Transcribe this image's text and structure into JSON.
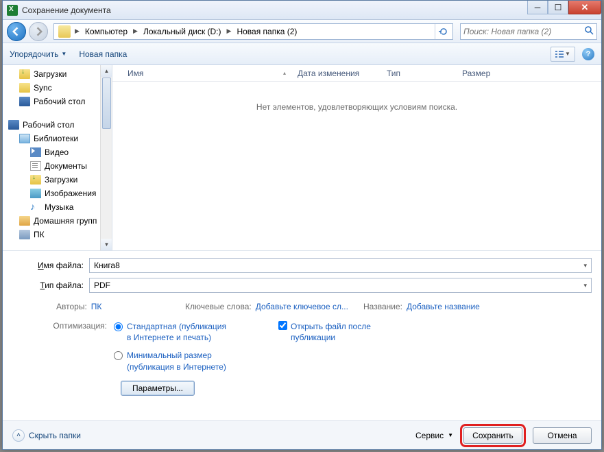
{
  "title": "Сохранение документа",
  "breadcrumb": [
    "Компьютер",
    "Локальный диск (D:)",
    "Новая папка (2)"
  ],
  "search_placeholder": "Поиск: Новая папка (2)",
  "toolbar": {
    "organize": "Упорядочить",
    "new_folder": "Новая папка"
  },
  "tree": {
    "downloads": "Загрузки",
    "sync": "Sync",
    "desktop1": "Рабочий стол",
    "desktop2": "Рабочий стол",
    "libraries": "Библиотеки",
    "video": "Видео",
    "documents": "Документы",
    "downloads2": "Загрузки",
    "images": "Изображения",
    "music": "Музыка",
    "homegroup": "Домашняя групп",
    "pc": "ПК"
  },
  "columns": {
    "name": "Имя",
    "date": "Дата изменения",
    "type": "Тип",
    "size": "Размер"
  },
  "empty": "Нет элементов, удовлетворяющих условиям поиска.",
  "form": {
    "filename_label": "Имя файла:",
    "filename_value": "Книга8",
    "filetype_label": "Тип файла:",
    "filetype_value": "PDF",
    "authors_label": "Авторы:",
    "authors_value": "ПК",
    "keywords_label": "Ключевые слова:",
    "keywords_link": "Добавьте ключевое сл...",
    "title_label": "Название:",
    "title_link": "Добавьте название",
    "optimization_label": "Оптимизация:",
    "opt_standard": "Стандартная (публикация в Интернете и печать)",
    "opt_min": "Минимальный размер (публикация в Интернете)",
    "open_after": "Открыть файл после публикации",
    "params_btn": "Параметры..."
  },
  "footer": {
    "hide_folders": "Скрыть папки",
    "service": "Сервис",
    "save": "Сохранить",
    "cancel": "Отмена"
  }
}
